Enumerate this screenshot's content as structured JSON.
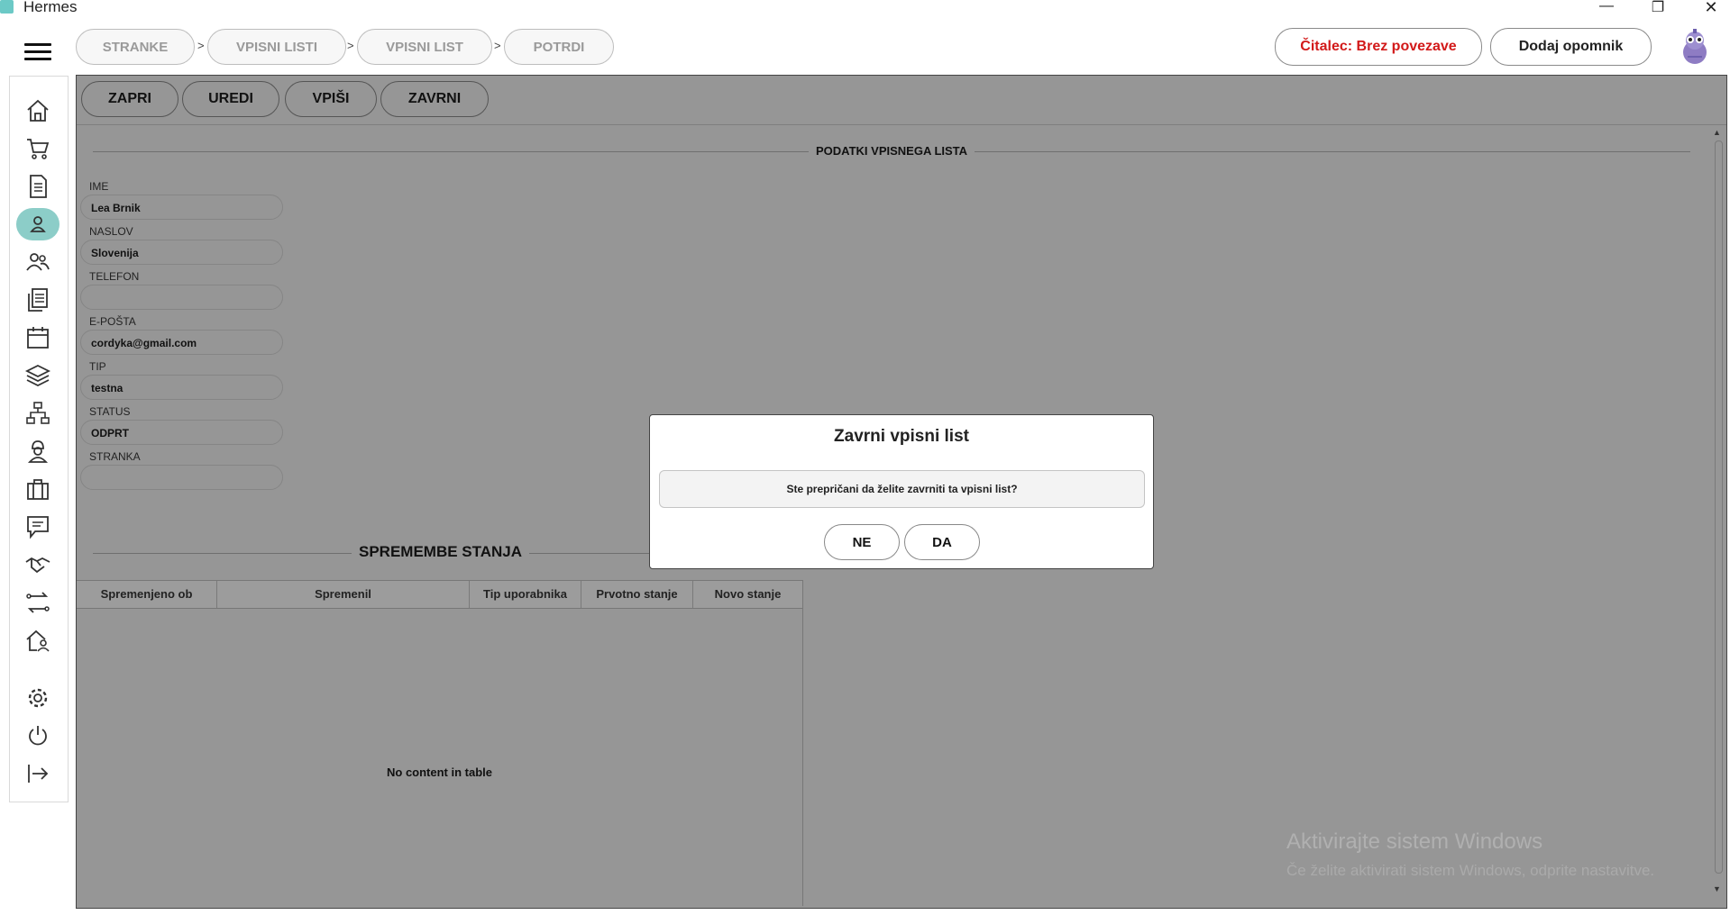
{
  "window": {
    "title": "Hermes",
    "minimize_label": "—",
    "maximize_label": "❐",
    "close_label": "✕"
  },
  "header": {
    "breadcrumbs": [
      "STRANKE",
      "VPISNI LISTI",
      "VPISNI LIST",
      "POTRDI"
    ],
    "separator": ">",
    "reader_button": "Čitalec: Brez povezave",
    "reminder_button": "Dodaj opomnik"
  },
  "sidebar": {
    "items": [
      "home-icon",
      "cart-icon",
      "document-icon",
      "user-icon",
      "users-icon",
      "documents-icon",
      "calendar-icon",
      "layers-icon",
      "network-icon",
      "worker-icon",
      "briefcase-icon",
      "message-icon",
      "handshake-icon",
      "transfer-icon",
      "house-icon",
      "gear-icon",
      "power-icon",
      "logout-icon"
    ],
    "active_item": "user-icon",
    "active_color": "#8ccdc8"
  },
  "toolbar": {
    "close": "ZAPRI",
    "edit": "UREDI",
    "enroll": "VPIŠI",
    "finish": "ZAVRNI"
  },
  "form": {
    "section_title": "PODATKI VPISNEGA LISTA",
    "fields": [
      {
        "label": "IME",
        "value": "Lea Brnik"
      },
      {
        "label": "NASLOV",
        "value": "Slovenija"
      },
      {
        "label": "TELEFON",
        "value": ""
      },
      {
        "label": "E-POŠTA",
        "value": "cordyka@gmail.com"
      },
      {
        "label": "TIP",
        "value": "testna"
      },
      {
        "label": "STATUS",
        "value": "ODPRT"
      },
      {
        "label": "STRANKA",
        "value": ""
      }
    ]
  },
  "history": {
    "section_title": "SPREMEMBE STANJA",
    "columns": [
      "Spremenjeno ob",
      "Spremenil",
      "Tip uporabnika",
      "Prvotno stanje",
      "Novo stanje"
    ],
    "empty_message": "No content in table"
  },
  "dialog": {
    "title": "Zavrni vpisni list",
    "message": "Ste prepričani da želite zavrniti ta vpisni list?",
    "no": "NE",
    "yes": "DA"
  },
  "watermark": {
    "title": "Aktivirajte sistem Windows",
    "subtitle": "Če želite aktivirati sistem Windows, odprite nastavitve."
  },
  "colors": {
    "overlay": "#969696",
    "reader_text": "#d21919"
  }
}
